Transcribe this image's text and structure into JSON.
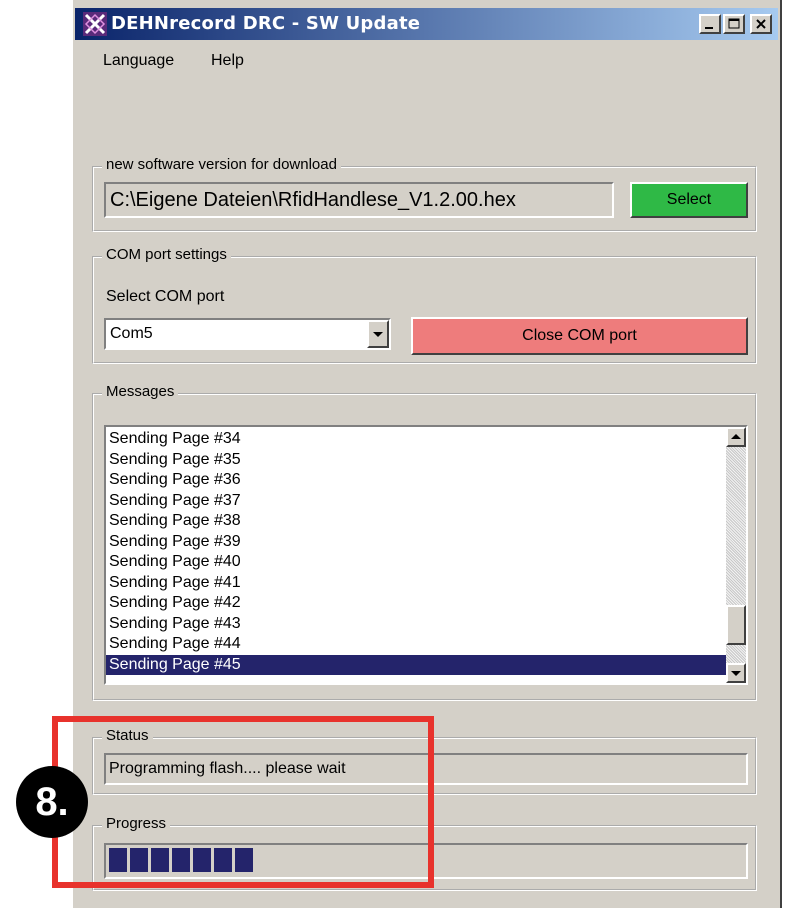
{
  "window": {
    "title": "DEHNrecord DRC - SW Update",
    "controls": [
      "minimize-icon",
      "maximize-icon",
      "close-icon"
    ]
  },
  "menu": {
    "items": [
      "Language",
      "Help"
    ]
  },
  "download": {
    "legend": "new software version for download",
    "file_path": "C:\\Eigene Dateien\\RfidHandlese_V1.2.00.hex",
    "select_label": "Select",
    "select_color": "#2fb946"
  },
  "com": {
    "legend": "COM port settings",
    "select_label": "Select COM port",
    "selected_port": "Com5",
    "close_label": "Close COM port",
    "close_color": "#ee7c7c"
  },
  "messages": {
    "legend": "Messages",
    "items": [
      "Sending Page #34",
      "Sending Page #35",
      "Sending Page #36",
      "Sending Page #37",
      "Sending Page #38",
      "Sending Page #39",
      "Sending Page #40",
      "Sending Page #41",
      "Sending Page #42",
      "Sending Page #43",
      "Sending Page #44",
      "Sending Page #45"
    ],
    "selected_index": 11
  },
  "status": {
    "legend": "Status",
    "text": "Programming flash.... please wait"
  },
  "progress": {
    "legend": "Progress",
    "blocks_filled": 7
  },
  "annotation": {
    "step": "8.",
    "color": "#e8322c"
  }
}
